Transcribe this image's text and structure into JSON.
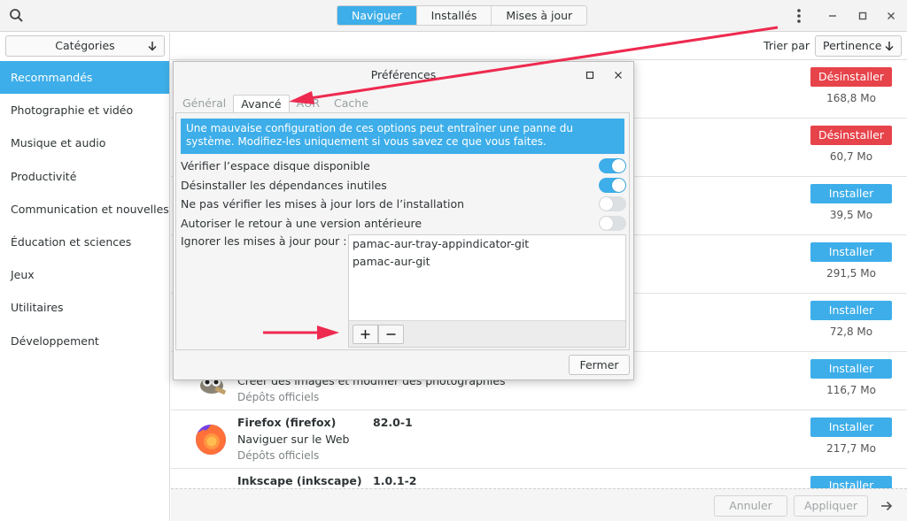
{
  "header": {
    "tabs": [
      {
        "label": "Naviguer",
        "active": true
      },
      {
        "label": "Installés",
        "active": false
      },
      {
        "label": "Mises à jour",
        "active": false
      }
    ]
  },
  "sidebar": {
    "category_select": "Catégories",
    "items": [
      {
        "label": "Recommandés",
        "active": true
      },
      {
        "label": "Photographie et vidéo"
      },
      {
        "label": "Musique et audio"
      },
      {
        "label": "Productivité"
      },
      {
        "label": "Communication et nouvelles"
      },
      {
        "label": "Éducation et sciences"
      },
      {
        "label": "Jeux"
      },
      {
        "label": "Utilitaires"
      },
      {
        "label": "Développement"
      }
    ]
  },
  "sortbar": {
    "label": "Trier par",
    "value": "Pertinence"
  },
  "packages": [
    {
      "name": "",
      "version": "",
      "description": "",
      "repo": "",
      "action": "Désinstaller",
      "size": "168,8 Mo"
    },
    {
      "name": "",
      "version": "",
      "description": "",
      "repo": "",
      "action": "Désinstaller",
      "size": "60,7 Mo"
    },
    {
      "name": "",
      "version": "",
      "description": "",
      "repo": "",
      "action": "Installer",
      "size": "39,5 Mo"
    },
    {
      "name": "",
      "version": "",
      "description": "",
      "repo": "",
      "action": "Installer",
      "size": "291,5 Mo"
    },
    {
      "name": "",
      "version": "",
      "description": "",
      "repo": "",
      "action": "Installer",
      "size": "72,8 Mo"
    },
    {
      "name": "",
      "version": "",
      "description": "Créer des images et modifier des photographies",
      "repo": "Dépôts officiels",
      "action": "Installer",
      "size": "116,7 Mo"
    },
    {
      "name": "Firefox (firefox)",
      "version": "82.0-1",
      "description": "Naviguer sur le Web",
      "repo": "Dépôts officiels",
      "action": "Installer",
      "size": "217,7 Mo"
    },
    {
      "name": "Inkscape (inkscape)",
      "version": "1.0.1-2",
      "description": "",
      "repo": "",
      "action": "Installer",
      "size": ""
    }
  ],
  "bottombar": {
    "cancel_label": "Annuler",
    "apply_label": "Appliquer"
  },
  "dialog": {
    "title": "Préférences",
    "tabs": [
      {
        "label": "Général",
        "active": false
      },
      {
        "label": "Avancé",
        "active": true
      },
      {
        "label": "AUR",
        "active": false
      },
      {
        "label": "Cache",
        "active": false
      }
    ],
    "warning": "Une mauvaise configuration de ces options peut entraîner une panne du système. Modifiez-les uniquement si vous savez ce que vous faites.",
    "options": [
      {
        "label": "Vérifier l’espace disque disponible",
        "enabled": true
      },
      {
        "label": "Désinstaller les dépendances inutiles",
        "enabled": true
      },
      {
        "label": "Ne pas vérifier les mises à jour lors de l’installation",
        "enabled": false
      },
      {
        "label": "Autoriser le retour à une version antérieure",
        "enabled": false
      }
    ],
    "ignore_label": "Ignorer les mises à jour pour :",
    "ignore_list": [
      "pamac-aur-tray-appindicator-git",
      "pamac-aur-git"
    ],
    "add_symbol": "+",
    "remove_symbol": "−",
    "close_label": "Fermer"
  },
  "colors": {
    "accent": "#3daee9",
    "danger": "#e7434a",
    "annotation": "#ee2a4f"
  }
}
